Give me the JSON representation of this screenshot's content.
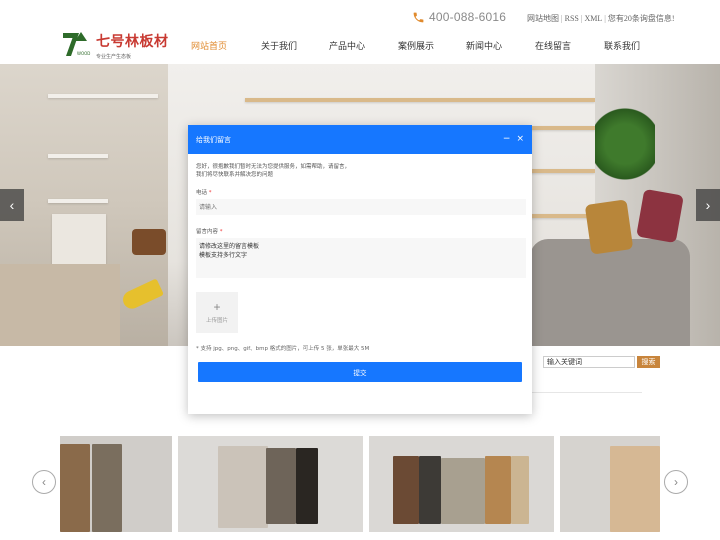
{
  "topbar": {
    "phone": "400-088-6016",
    "links": [
      "网站地图",
      "RSS",
      "XML",
      "您有20条询盘信息!"
    ]
  },
  "logo": {
    "mark": "7",
    "mark_sub": "WOOD",
    "title": "七号林板材",
    "subtitle": "专业生产生态板"
  },
  "nav": [
    {
      "label": "网站首页",
      "active": true
    },
    {
      "label": "关于我们",
      "active": false
    },
    {
      "label": "产品中心",
      "active": false
    },
    {
      "label": "案例展示",
      "active": false
    },
    {
      "label": "新闻中心",
      "active": false
    },
    {
      "label": "在线留言",
      "active": false
    },
    {
      "label": "联系我们",
      "active": false
    }
  ],
  "banner": {
    "prev": "‹",
    "next": "›"
  },
  "search": {
    "value": "输入关键词",
    "button": "搜索"
  },
  "carousel": {
    "prev": "‹",
    "next": "›"
  },
  "modal": {
    "title": "给我们留言",
    "minimize": "−",
    "close": "×",
    "desc_line1": "您好，很抱歉我们暂时无法为您提供服务，如需帮助，请留言，",
    "desc_line2": "我们将尽快联系并解决您的问题",
    "phone_label": "电话",
    "phone_placeholder": "请输入",
    "message_label": "留言内容",
    "message_line1": "请修改这里的留言模板",
    "message_line2": "模板支持多行文字",
    "upload_plus": "+",
    "upload_label": "上传图片",
    "hint": "* 支持 jpg、png、gif、bmp 格式的图片，可上传 5 张，单张最大 5M",
    "submit": "提交"
  },
  "colors": {
    "accent": "#1677ff",
    "nav_active": "#e08a2d",
    "brand": "#c83a32",
    "search_btn": "#c8853c"
  }
}
